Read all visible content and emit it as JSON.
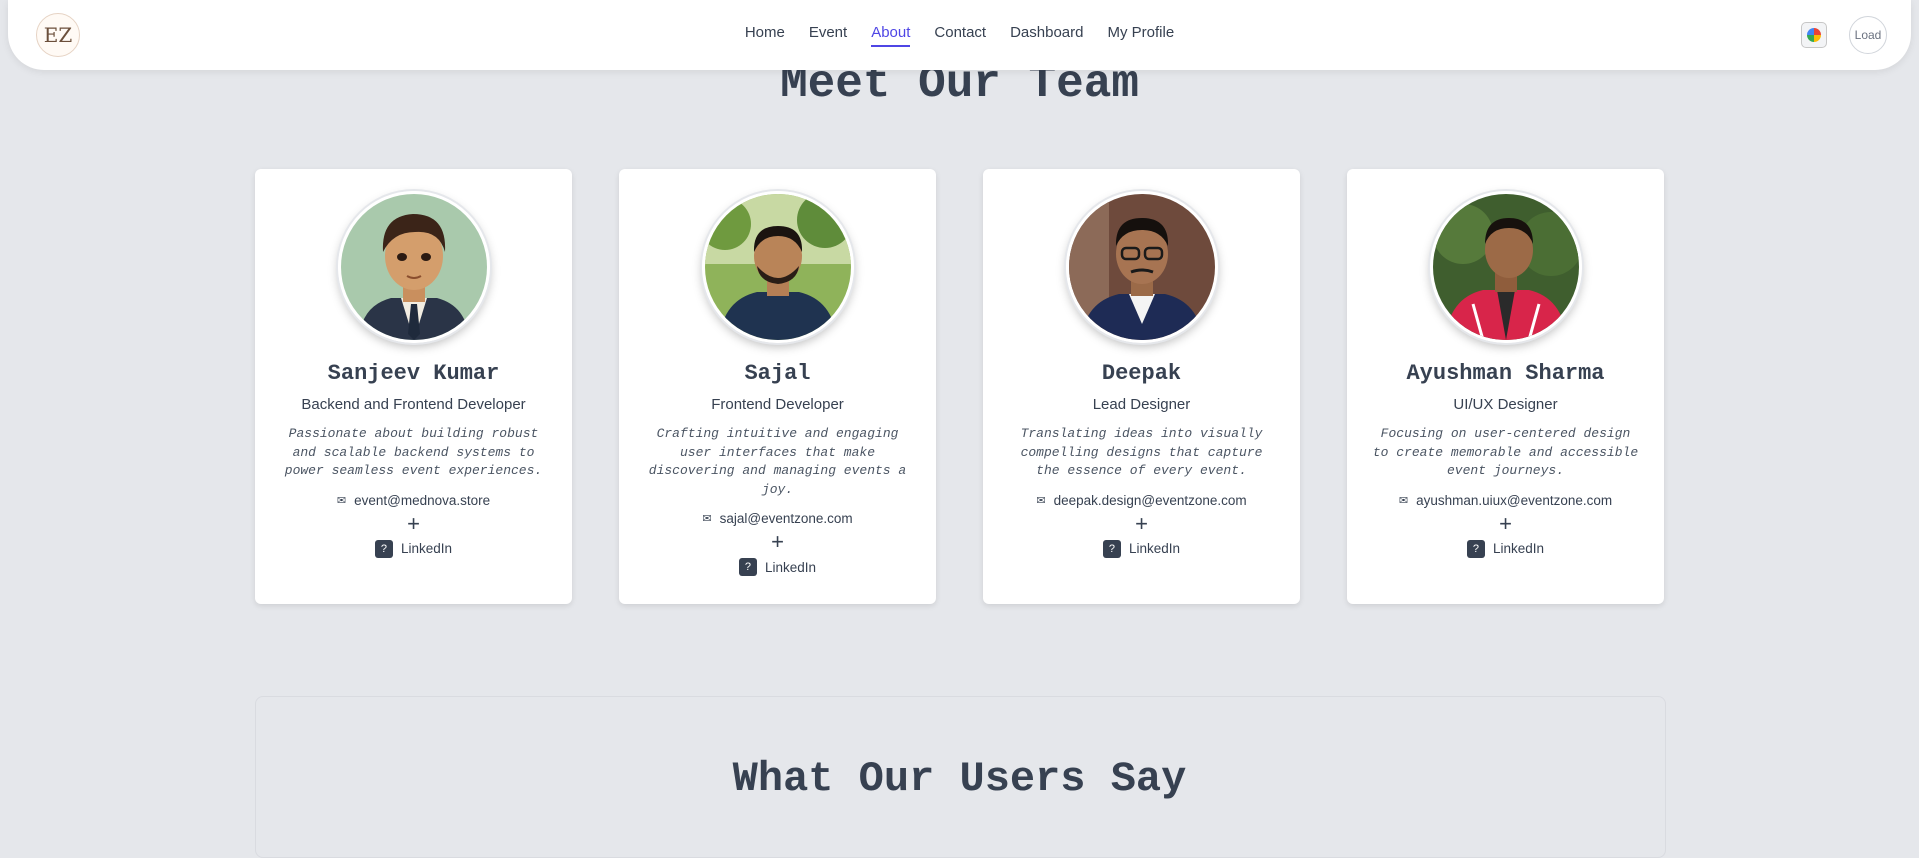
{
  "navbar": {
    "logo_text": "EZ",
    "links": [
      {
        "label": "Home",
        "active": false
      },
      {
        "label": "Event",
        "active": false
      },
      {
        "label": "About",
        "active": true
      },
      {
        "label": "Contact",
        "active": false
      },
      {
        "label": "Dashboard",
        "active": false
      },
      {
        "label": "My Profile",
        "active": false
      }
    ],
    "avatar_alt": "Load"
  },
  "team_section": {
    "title": "Meet Our Team",
    "members": [
      {
        "name": "Sanjeev Kumar",
        "role": "Backend and Frontend Developer",
        "bio": "Passionate about building robust and scalable backend systems to power seamless event experiences.",
        "email": "event@mednova.store",
        "linkedin_label": "LinkedIn"
      },
      {
        "name": "Sajal",
        "role": "Frontend Developer",
        "bio": "Crafting intuitive and engaging user interfaces that make discovering and managing events a joy.",
        "email": "sajal@eventzone.com",
        "linkedin_label": "LinkedIn"
      },
      {
        "name": "Deepak",
        "role": "Lead Designer",
        "bio": "Translating ideas into visually compelling designs that capture the essence of every event.",
        "email": "deepak.design@eventzone.com",
        "linkedin_label": "LinkedIn"
      },
      {
        "name": "Ayushman Sharma",
        "role": "UI/UX Designer",
        "bio": "Focusing on user-centered design to create memorable and accessible event journeys.",
        "email": "ayushman.uiux@eventzone.com",
        "linkedin_label": "LinkedIn"
      }
    ],
    "plus_symbol": "+"
  },
  "testimonials_section": {
    "title": "What Our Users Say"
  },
  "colors": {
    "accent": "#4f46e5",
    "background": "#e5e7eb",
    "text": "#374151"
  }
}
